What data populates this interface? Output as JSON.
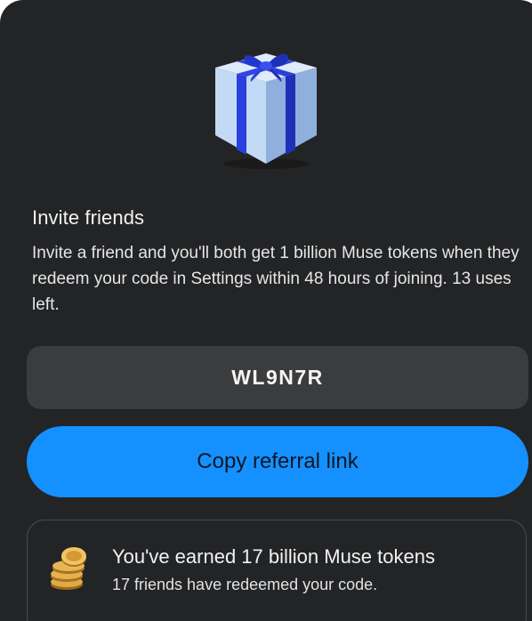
{
  "invite": {
    "title": "Invite friends",
    "description": "Invite a friend and you'll both get 1 billion Muse tokens when they redeem your code in Settings within 48 hours of joining. 13 uses left.",
    "gift_icon": "gift-box-icon"
  },
  "referral": {
    "code": "WL9N7R",
    "copy_label": "Copy referral link"
  },
  "earned": {
    "title": "You've earned 17 billion Muse tokens",
    "subtitle": "17 friends have redeemed your code.",
    "coins_icon": "coins-icon"
  },
  "colors": {
    "background": "#232426",
    "code_box": "#3b3c3e",
    "accent": "#1491ff",
    "gift_box": "#b7d3f5",
    "gift_ribbon": "#2438d4",
    "coin_gold": "#d8a23a"
  }
}
